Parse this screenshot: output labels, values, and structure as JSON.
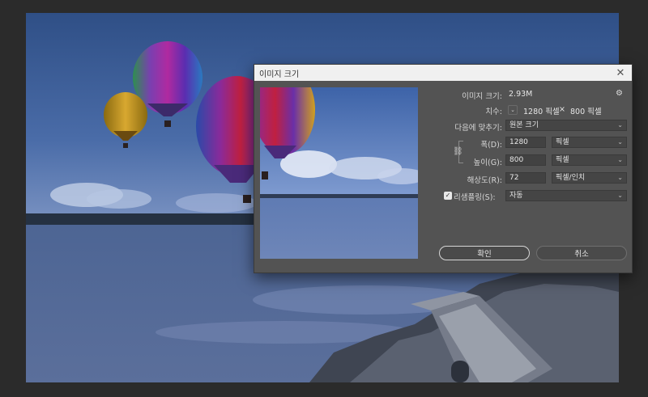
{
  "dialog": {
    "title": "이미지 크기",
    "image_size_label": "이미지 크기:",
    "image_size_value": "2.93M",
    "dimensions_label": "치수:",
    "dimensions_width": "1280 픽셀",
    "dimensions_sep": "×",
    "dimensions_height": "800 픽셀",
    "fit_to_label": "다음에 맞추기:",
    "fit_to_value": "원본 크기",
    "width_label": "폭(D):",
    "width_value": "1280",
    "width_unit": "픽셀",
    "height_label": "높이(G):",
    "height_value": "800",
    "height_unit": "픽셀",
    "resolution_label": "해상도(R):",
    "resolution_value": "72",
    "resolution_unit": "픽셀/인치",
    "resample_label": "리샘플링(S):",
    "resample_checked": "✓",
    "resample_value": "자동",
    "ok_label": "확인",
    "cancel_label": "취소",
    "close_glyph": "✕",
    "gear_glyph": "⚙",
    "chevron_glyph": "⌄",
    "link_glyph": "⛓"
  },
  "colors": {
    "dialog_bg": "#535353",
    "titlebar_bg": "#f0f0f0",
    "app_bg": "#2b2b2b"
  }
}
